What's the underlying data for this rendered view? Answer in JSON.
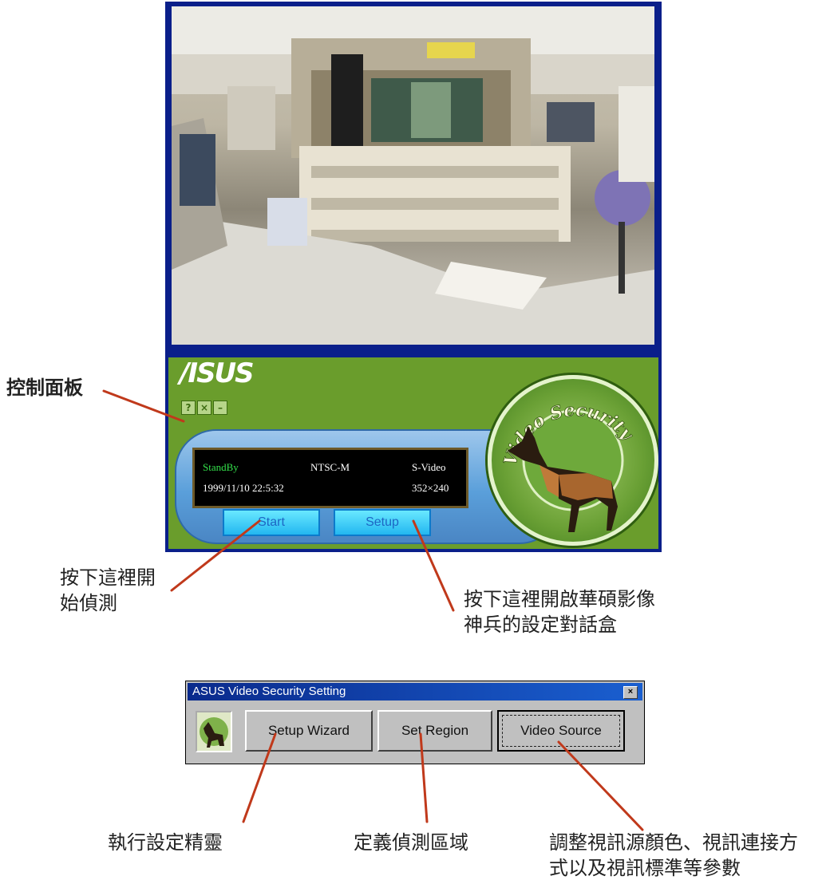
{
  "camera_panel": {
    "brand": "/ISUS",
    "window_buttons": [
      "?",
      "×",
      "–"
    ],
    "status": {
      "state": "StandBy",
      "standard": "NTSC-M",
      "source": "S-Video",
      "datetime": "1999/11/10 22:5:32",
      "resolution": "352×240"
    },
    "start_label": "Start",
    "setup_label": "Setup",
    "badge_text": "Video Security",
    "colors": {
      "panel": "#6a9d2c",
      "frame": "#0a1f8a",
      "lcd_state": "#33e04a"
    }
  },
  "dialog": {
    "title": "ASUS Video Security Setting",
    "close": "×",
    "buttons": [
      "Setup Wizard",
      "Set Region",
      "Video Source"
    ]
  },
  "annotations": {
    "control_panel": "控制面板",
    "start_note": [
      "按下這裡開",
      "始偵測"
    ],
    "setup_note": [
      "按下這裡開啟華碩影像",
      "神兵的設定對話盒"
    ],
    "wizard_note": "執行設定精靈",
    "region_note": "定義偵測區域",
    "source_note": [
      "調整視訊源顏色、視訊連接方",
      "式以及視訊標準等參數"
    ]
  }
}
